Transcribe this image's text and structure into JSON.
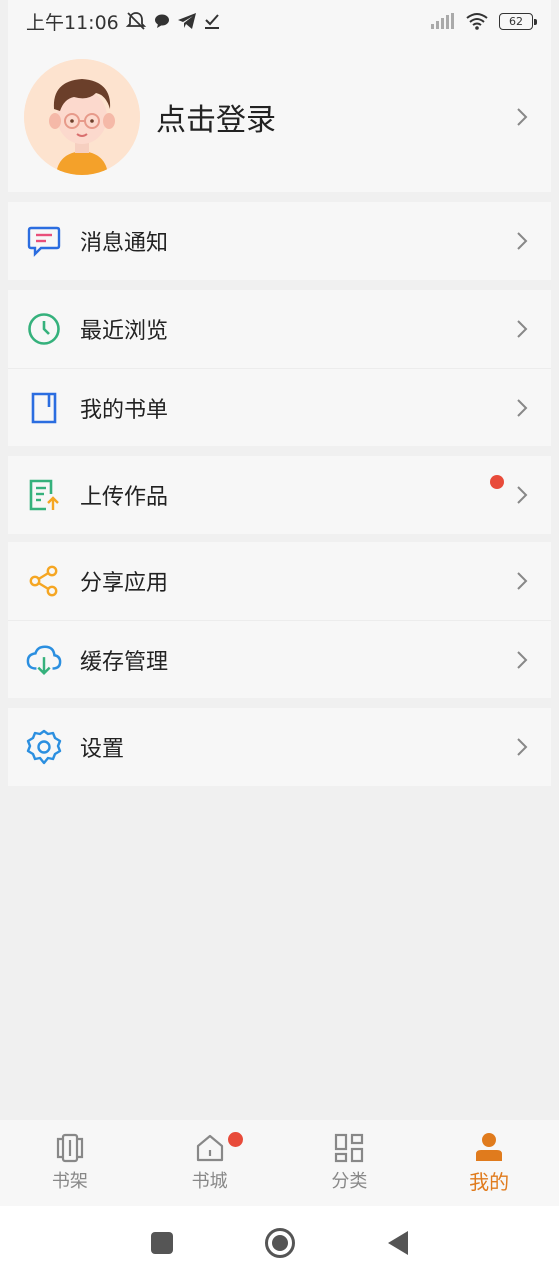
{
  "status_bar": {
    "time": "上午11:06",
    "battery": "62"
  },
  "profile": {
    "login_label": "点击登录"
  },
  "menu": {
    "messages": "消息通知",
    "recent": "最近浏览",
    "booklist": "我的书单",
    "upload": "上传作品",
    "share": "分享应用",
    "cache": "缓存管理",
    "settings": "设置"
  },
  "bottom_nav": {
    "items": [
      {
        "label": "书架",
        "icon": "bookshelf-icon"
      },
      {
        "label": "书城",
        "icon": "home-icon"
      },
      {
        "label": "分类",
        "icon": "category-grid-icon"
      },
      {
        "label": "我的",
        "icon": "person-icon"
      }
    ],
    "active_index": 3,
    "accent_color": "#e07b1d"
  },
  "colors": {
    "badge_red": "#e84b3a",
    "background": "#f0f0f0"
  }
}
